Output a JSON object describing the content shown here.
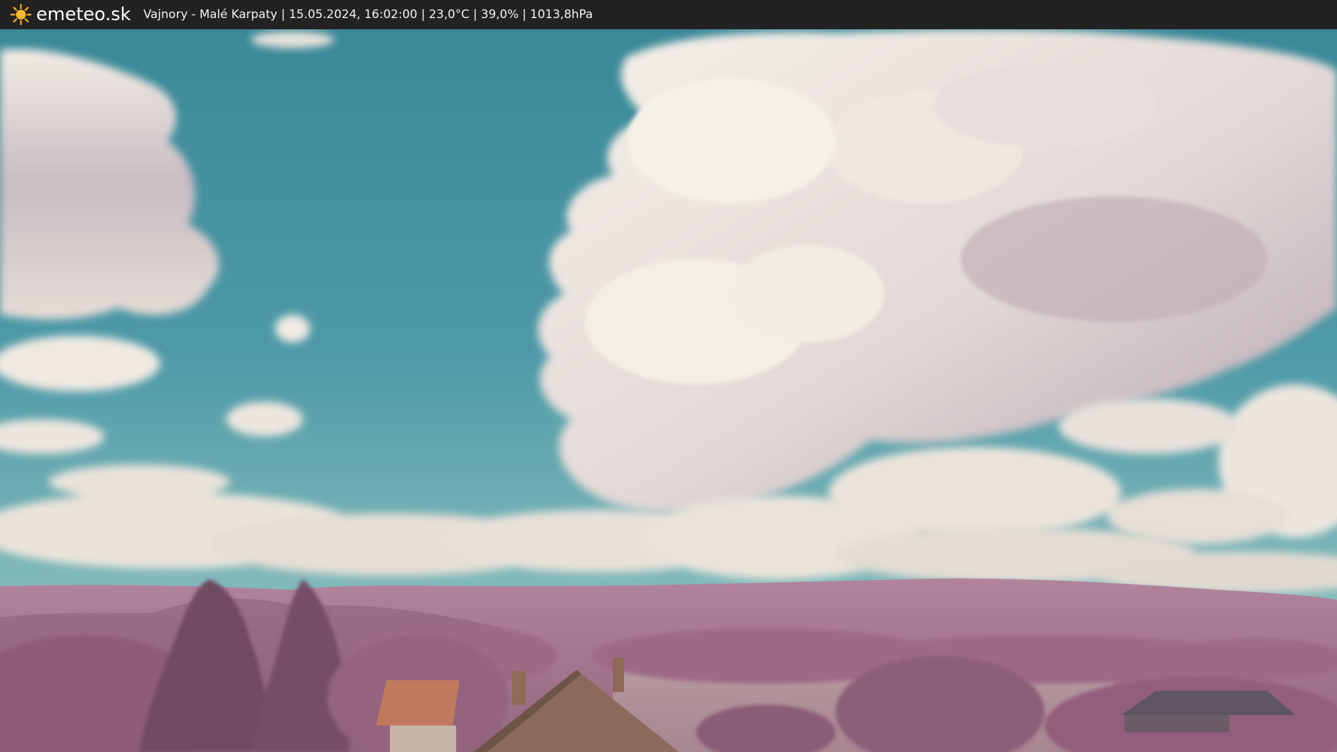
{
  "header": {
    "brand": "emeteo.sk",
    "caption": "Vajnory - Malé Karpaty | 15.05.2024, 16:02:00 | 23,0°C | 39,0% | 1013,8hPa",
    "brand_icon": "sun-icon"
  },
  "colors": {
    "topbar": "#222222",
    "sky_top": "#3f8d9c",
    "sky_bottom": "#8fc3c3",
    "cloud": "#f1ece6",
    "cloud_shadow": "#b9a9b2",
    "hills": "#a67892",
    "foliage": "#9c6884",
    "sun": "#f5a623"
  }
}
